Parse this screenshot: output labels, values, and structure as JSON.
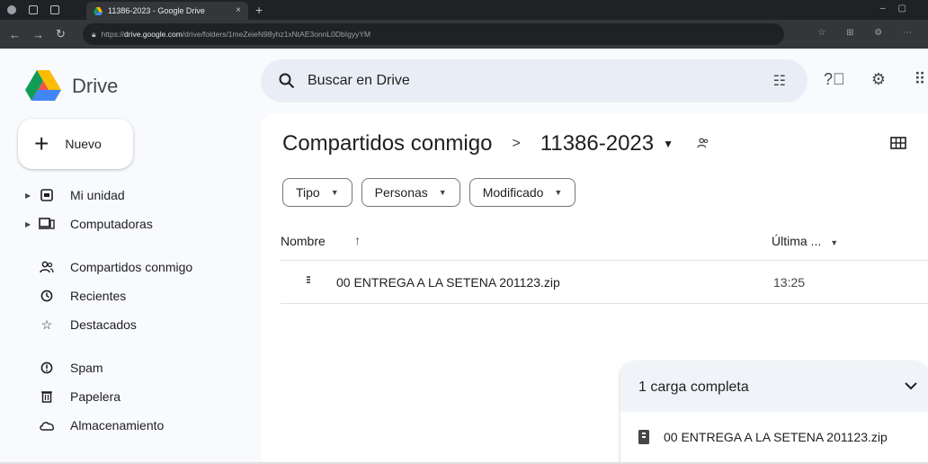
{
  "browser": {
    "tab_title": "11386-2023 - Google Drive",
    "tab_close": "×",
    "new_tab": "+",
    "url_prefix": "https://",
    "url_domain": "drive.google.com",
    "url_path": "/drive/folders/1meZeieN98yhz1xNtAE3onnL0DbIgyyYM"
  },
  "app": {
    "logo_text": "Drive",
    "search_placeholder": "Buscar en Drive"
  },
  "sidebar": {
    "new_label": "Nuevo",
    "items": [
      {
        "label": "Mi unidad",
        "icon": "my-drive-icon"
      },
      {
        "label": "Computadoras",
        "icon": "computers-icon"
      },
      {
        "label": "Compartidos conmigo",
        "icon": "shared-icon"
      },
      {
        "label": "Recientes",
        "icon": "clock-icon"
      },
      {
        "label": "Destacados",
        "icon": "star-icon"
      },
      {
        "label": "Spam",
        "icon": "spam-icon"
      },
      {
        "label": "Papelera",
        "icon": "trash-icon"
      },
      {
        "label": "Almacenamiento",
        "icon": "cloud-icon"
      }
    ]
  },
  "breadcrumb": {
    "parent": "Compartidos conmigo",
    "separator": ">",
    "current": "11386-2023"
  },
  "filters": [
    "Tipo",
    "Personas",
    "Modificado"
  ],
  "table": {
    "col_name": "Nombre",
    "col_modified": "Última ...",
    "rows": [
      {
        "name": "00 ENTREGA A LA SETENA 201123.zip",
        "modified": "13:25"
      }
    ]
  },
  "upload_panel": {
    "title": "1 carga completa",
    "file": "00 ENTREGA A LA SETENA 201123.zip"
  },
  "colors": {
    "accent": "#0b57d0",
    "search_bg": "#e9eef6",
    "app_bg": "#f8fafd"
  }
}
